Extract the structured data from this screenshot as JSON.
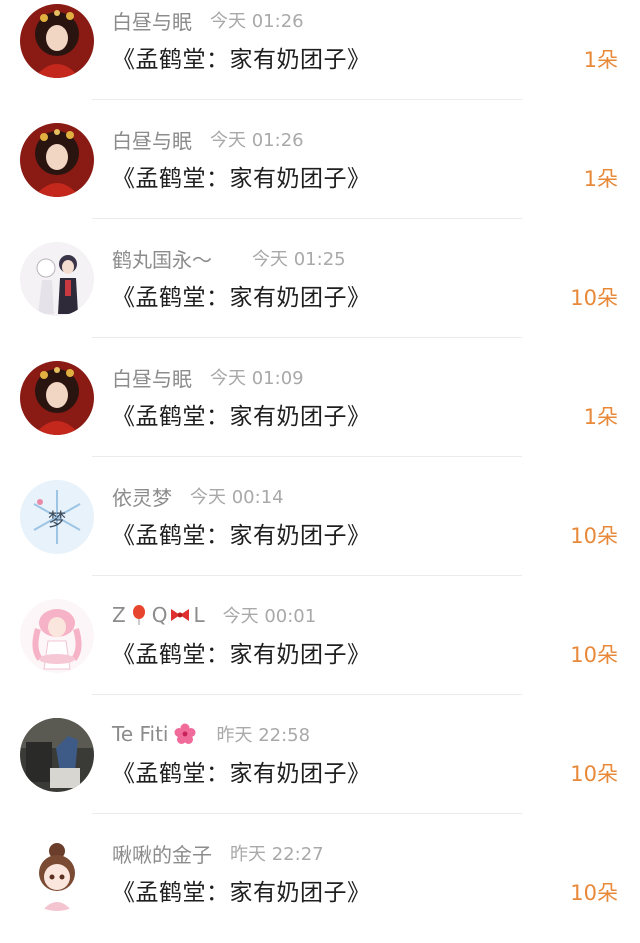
{
  "items": [
    {
      "user": "白昼与眠",
      "time": "今天 01:26",
      "title": "《孟鹤堂：家有奶团子》",
      "gift": "1朵",
      "avatar": "avatar-red-dress"
    },
    {
      "user": "白昼与眠",
      "time": "今天 01:26",
      "title": "《孟鹤堂：家有奶团子》",
      "gift": "1朵",
      "avatar": "avatar-red-dress"
    },
    {
      "user": "鹤丸国永～",
      "time": "今天 01:25",
      "title": "《孟鹤堂：家有奶团子》",
      "gift": "10朵",
      "avatar": "avatar-anime-duo"
    },
    {
      "user": "白昼与眠",
      "time": "今天 01:09",
      "title": "《孟鹤堂：家有奶团子》",
      "gift": "1朵",
      "avatar": "avatar-red-dress"
    },
    {
      "user": "依灵梦",
      "time": "今天 00:14",
      "title": "《孟鹤堂：家有奶团子》",
      "gift": "10朵",
      "avatar": "avatar-snowflake-meng"
    },
    {
      "user_a": "Z",
      "user_b": "Q",
      "user_c": "L",
      "time": "今天 00:01",
      "title": "《孟鹤堂：家有奶团子》",
      "gift": "10朵",
      "avatar": "avatar-pink-girl",
      "emoji_1": "balloon-icon",
      "emoji_2": "bow-icon"
    },
    {
      "user": "Te Fiti",
      "time": "昨天 22:58",
      "title": "《孟鹤堂：家有奶团子》",
      "gift": "10朵",
      "avatar": "avatar-photo-jeans",
      "emoji_1": "hibiscus-icon"
    },
    {
      "user": "啾啾的金子",
      "time": "昨天 22:27",
      "title": "《孟鹤堂：家有奶团子》",
      "gift": "10朵",
      "avatar": "avatar-chibi-girl"
    }
  ],
  "colors": {
    "username": "#8c8c8c",
    "time": "#a9a9a9",
    "title": "#1f1f1f",
    "gift": "#e8893a",
    "divider": "#ececec"
  }
}
